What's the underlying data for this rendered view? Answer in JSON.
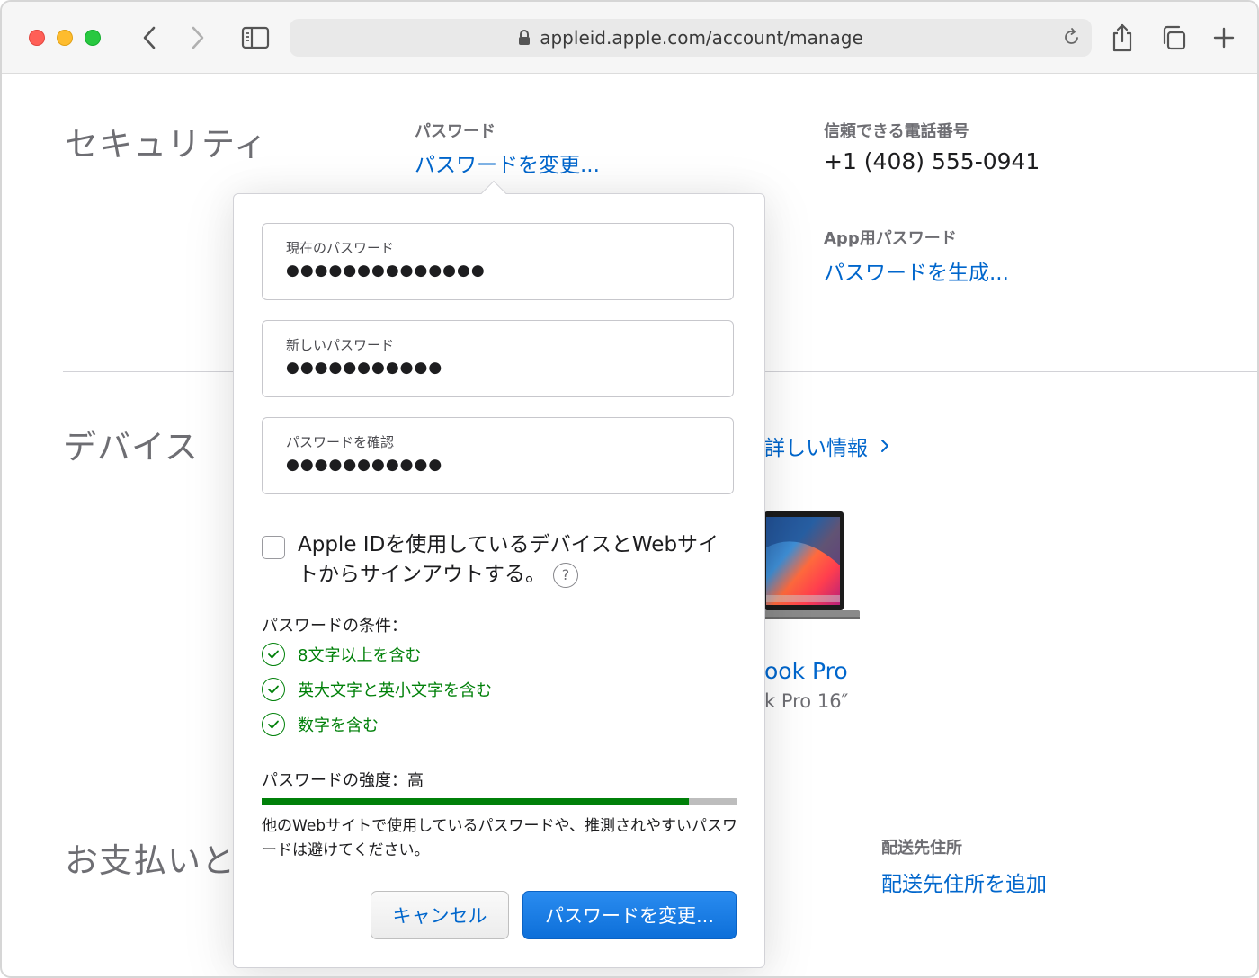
{
  "browser": {
    "url": "appleid.apple.com/account/manage"
  },
  "security": {
    "title": "セキュリティ",
    "password_label": "パスワード",
    "password_link": "パスワードを変更...",
    "phone_label": "信頼できる電話番号",
    "phone_value": "+1 (408) 555-0941",
    "app_password_label": "App用パスワード",
    "app_password_link": "パスワードを生成..."
  },
  "devices": {
    "title": "デバイス",
    "more_info_link": "詳しい情報",
    "device_name_partial": "ook Pro",
    "device_model_partial": "k Pro 16″"
  },
  "payment": {
    "title_partial": "お支払いと配",
    "shipping_label": "配送先住所",
    "shipping_link": "配送先住所を追加"
  },
  "dialog": {
    "current_password_label": "現在のパスワード",
    "current_password_value": "●●●●●●●●●●●●●●",
    "new_password_label": "新しいパスワード",
    "new_password_value": "●●●●●●●●●●●",
    "confirm_password_label": "パスワードを確認",
    "confirm_password_value": "●●●●●●●●●●●",
    "signout_text": "Apple IDを使用しているデバイスとWebサイトからサインアウトする。",
    "signout_checked": false,
    "help_glyph": "?",
    "requirements_title": "パスワードの条件：",
    "requirements": [
      {
        "text": "8文字以上を含む",
        "met": true
      },
      {
        "text": "英大文字と英小文字を含む",
        "met": true
      },
      {
        "text": "数字を含む",
        "met": true
      }
    ],
    "strength_label": "パスワードの強度：高",
    "strength_fraction": 0.9,
    "note": "他のWebサイトで使用しているパスワードや、推測されやすいパスワードは避けてください。",
    "cancel_button": "キャンセル",
    "submit_button": "パスワードを変更..."
  },
  "colors": {
    "link": "#0066cc",
    "success": "#008009",
    "primary_button": "#0d6fd9"
  },
  "icons": [
    "back-icon",
    "forward-icon",
    "sidebar-icon",
    "lock-icon",
    "reload-icon",
    "share-icon",
    "tabs-icon",
    "new-tab-icon",
    "chevron-right-icon",
    "checkmark-icon",
    "help-icon"
  ]
}
